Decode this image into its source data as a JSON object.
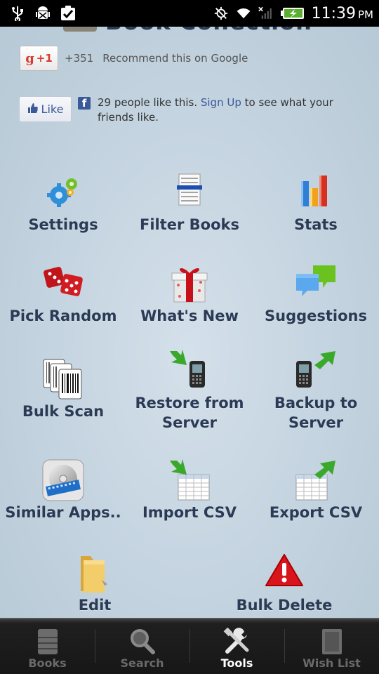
{
  "status_bar": {
    "time": "11:39",
    "ampm": "PM",
    "icons": [
      "usb-icon",
      "android-debug-icon",
      "download-done-icon",
      "gps-off-icon",
      "wifi-icon",
      "no-signal-icon",
      "battery-charging-icon"
    ]
  },
  "header": {
    "title_cut": "Book Collection"
  },
  "gplus": {
    "button_label": "+1",
    "count": "+351",
    "text": "Recommend this on Google"
  },
  "facebook": {
    "like_label": "Like",
    "text_before": "29 people like this. ",
    "link": "Sign Up",
    "text_after": " to see what your friends like."
  },
  "tools": {
    "settings": "Settings",
    "filter_books": "Filter Books",
    "stats": "Stats",
    "pick_random": "Pick Random",
    "whats_new": "What's New",
    "suggestions": "Suggestions",
    "bulk_scan": "Bulk Scan",
    "restore_line1": "Restore from",
    "restore_line2": "Server",
    "backup_line1": "Backup to",
    "backup_line2": "Server",
    "similar_apps": "Similar Apps..",
    "import_csv": "Import CSV",
    "export_csv": "Export CSV",
    "edit_categories": "Edit Categories",
    "bulk_delete": "Bulk Delete"
  },
  "tabs": [
    {
      "label": "Books",
      "icon": "books-icon",
      "active": false
    },
    {
      "label": "Search",
      "icon": "search-icon",
      "active": false
    },
    {
      "label": "Tools",
      "icon": "tools-icon",
      "active": true
    },
    {
      "label": "Wish List",
      "icon": "wish-list-icon",
      "active": false
    }
  ],
  "colors": {
    "background": "#c0d0dd",
    "label_text": "#2b3a55",
    "tabbar": "#171717",
    "tab_active": "#ffffff",
    "tab_inactive": "#6a6a6a",
    "facebook_blue": "#3b5998",
    "google_red": "#d73d32"
  }
}
